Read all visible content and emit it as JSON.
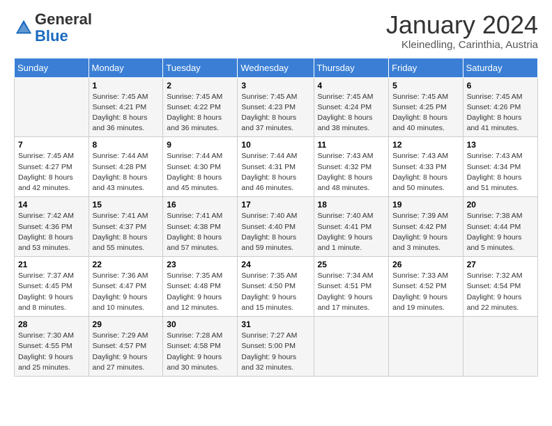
{
  "logo": {
    "general": "General",
    "blue": "Blue"
  },
  "header": {
    "month": "January 2024",
    "location": "Kleinedling, Carinthia, Austria"
  },
  "weekdays": [
    "Sunday",
    "Monday",
    "Tuesday",
    "Wednesday",
    "Thursday",
    "Friday",
    "Saturday"
  ],
  "weeks": [
    [
      {
        "day": "",
        "info": ""
      },
      {
        "day": "1",
        "info": "Sunrise: 7:45 AM\nSunset: 4:21 PM\nDaylight: 8 hours\nand 36 minutes."
      },
      {
        "day": "2",
        "info": "Sunrise: 7:45 AM\nSunset: 4:22 PM\nDaylight: 8 hours\nand 36 minutes."
      },
      {
        "day": "3",
        "info": "Sunrise: 7:45 AM\nSunset: 4:23 PM\nDaylight: 8 hours\nand 37 minutes."
      },
      {
        "day": "4",
        "info": "Sunrise: 7:45 AM\nSunset: 4:24 PM\nDaylight: 8 hours\nand 38 minutes."
      },
      {
        "day": "5",
        "info": "Sunrise: 7:45 AM\nSunset: 4:25 PM\nDaylight: 8 hours\nand 40 minutes."
      },
      {
        "day": "6",
        "info": "Sunrise: 7:45 AM\nSunset: 4:26 PM\nDaylight: 8 hours\nand 41 minutes."
      }
    ],
    [
      {
        "day": "7",
        "info": "Sunrise: 7:45 AM\nSunset: 4:27 PM\nDaylight: 8 hours\nand 42 minutes."
      },
      {
        "day": "8",
        "info": "Sunrise: 7:44 AM\nSunset: 4:28 PM\nDaylight: 8 hours\nand 43 minutes."
      },
      {
        "day": "9",
        "info": "Sunrise: 7:44 AM\nSunset: 4:30 PM\nDaylight: 8 hours\nand 45 minutes."
      },
      {
        "day": "10",
        "info": "Sunrise: 7:44 AM\nSunset: 4:31 PM\nDaylight: 8 hours\nand 46 minutes."
      },
      {
        "day": "11",
        "info": "Sunrise: 7:43 AM\nSunset: 4:32 PM\nDaylight: 8 hours\nand 48 minutes."
      },
      {
        "day": "12",
        "info": "Sunrise: 7:43 AM\nSunset: 4:33 PM\nDaylight: 8 hours\nand 50 minutes."
      },
      {
        "day": "13",
        "info": "Sunrise: 7:43 AM\nSunset: 4:34 PM\nDaylight: 8 hours\nand 51 minutes."
      }
    ],
    [
      {
        "day": "14",
        "info": "Sunrise: 7:42 AM\nSunset: 4:36 PM\nDaylight: 8 hours\nand 53 minutes."
      },
      {
        "day": "15",
        "info": "Sunrise: 7:41 AM\nSunset: 4:37 PM\nDaylight: 8 hours\nand 55 minutes."
      },
      {
        "day": "16",
        "info": "Sunrise: 7:41 AM\nSunset: 4:38 PM\nDaylight: 8 hours\nand 57 minutes."
      },
      {
        "day": "17",
        "info": "Sunrise: 7:40 AM\nSunset: 4:40 PM\nDaylight: 8 hours\nand 59 minutes."
      },
      {
        "day": "18",
        "info": "Sunrise: 7:40 AM\nSunset: 4:41 PM\nDaylight: 9 hours\nand 1 minute."
      },
      {
        "day": "19",
        "info": "Sunrise: 7:39 AM\nSunset: 4:42 PM\nDaylight: 9 hours\nand 3 minutes."
      },
      {
        "day": "20",
        "info": "Sunrise: 7:38 AM\nSunset: 4:44 PM\nDaylight: 9 hours\nand 5 minutes."
      }
    ],
    [
      {
        "day": "21",
        "info": "Sunrise: 7:37 AM\nSunset: 4:45 PM\nDaylight: 9 hours\nand 8 minutes."
      },
      {
        "day": "22",
        "info": "Sunrise: 7:36 AM\nSunset: 4:47 PM\nDaylight: 9 hours\nand 10 minutes."
      },
      {
        "day": "23",
        "info": "Sunrise: 7:35 AM\nSunset: 4:48 PM\nDaylight: 9 hours\nand 12 minutes."
      },
      {
        "day": "24",
        "info": "Sunrise: 7:35 AM\nSunset: 4:50 PM\nDaylight: 9 hours\nand 15 minutes."
      },
      {
        "day": "25",
        "info": "Sunrise: 7:34 AM\nSunset: 4:51 PM\nDaylight: 9 hours\nand 17 minutes."
      },
      {
        "day": "26",
        "info": "Sunrise: 7:33 AM\nSunset: 4:52 PM\nDaylight: 9 hours\nand 19 minutes."
      },
      {
        "day": "27",
        "info": "Sunrise: 7:32 AM\nSunset: 4:54 PM\nDaylight: 9 hours\nand 22 minutes."
      }
    ],
    [
      {
        "day": "28",
        "info": "Sunrise: 7:30 AM\nSunset: 4:55 PM\nDaylight: 9 hours\nand 25 minutes."
      },
      {
        "day": "29",
        "info": "Sunrise: 7:29 AM\nSunset: 4:57 PM\nDaylight: 9 hours\nand 27 minutes."
      },
      {
        "day": "30",
        "info": "Sunrise: 7:28 AM\nSunset: 4:58 PM\nDaylight: 9 hours\nand 30 minutes."
      },
      {
        "day": "31",
        "info": "Sunrise: 7:27 AM\nSunset: 5:00 PM\nDaylight: 9 hours\nand 32 minutes."
      },
      {
        "day": "",
        "info": ""
      },
      {
        "day": "",
        "info": ""
      },
      {
        "day": "",
        "info": ""
      }
    ]
  ]
}
